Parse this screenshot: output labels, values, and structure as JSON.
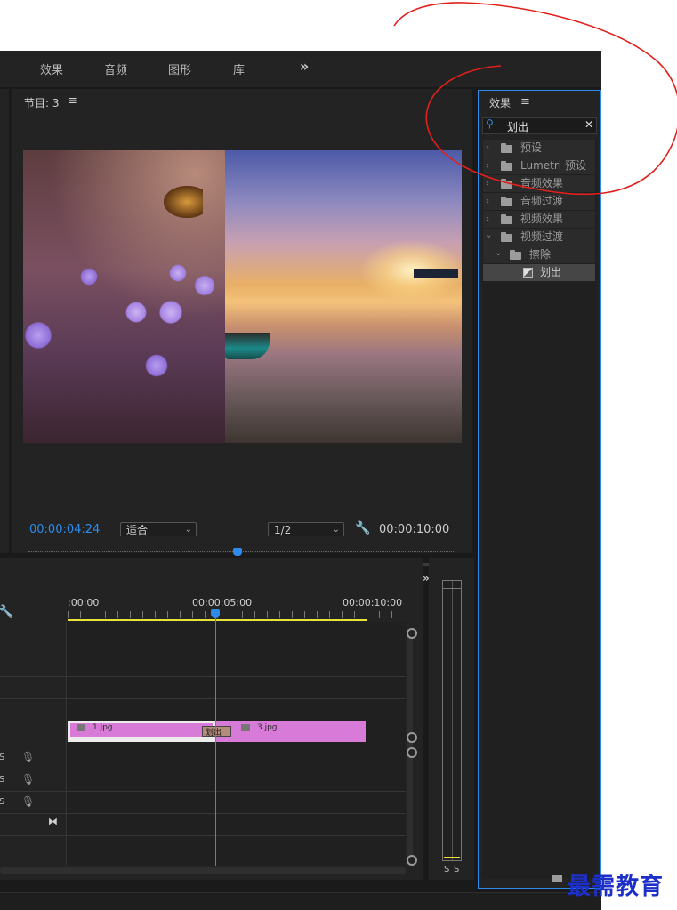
{
  "menu": {
    "effects": "效果",
    "audio": "音频",
    "graphics": "图形",
    "libraries": "库",
    "overflow": "»"
  },
  "program_monitor": {
    "title": "节目: 3",
    "timecode": "00:00:04:24",
    "fit_label": "适合",
    "resolution": "1/2",
    "duration": "00:00:10:00"
  },
  "effects_panel": {
    "title": "效果",
    "search_value": "划出",
    "tree": [
      {
        "label": "预设"
      },
      {
        "label": "Lumetri 预设"
      },
      {
        "label": "音频效果"
      },
      {
        "label": "音频过渡"
      },
      {
        "label": "视频效果"
      },
      {
        "label": "视频过渡"
      },
      {
        "label": "擦除"
      },
      {
        "label": "划出"
      }
    ]
  },
  "timeline": {
    "ruler": [
      ":00:00",
      "00:00:05:00",
      "00:00:10:00"
    ],
    "clip1_label": "1.jpg",
    "clip2_label": "3.jpg",
    "transition_label": "划出",
    "audio_track_label": "S"
  },
  "meter": {
    "solo_left": "S",
    "solo_right": "S"
  },
  "watermark": "最需教育",
  "colors": {
    "accent_blue": "#2d8ceb",
    "clip_pink": "#d87ad8",
    "annotation_red": "#e0201c",
    "work_area_yellow": "#e8e23a"
  }
}
